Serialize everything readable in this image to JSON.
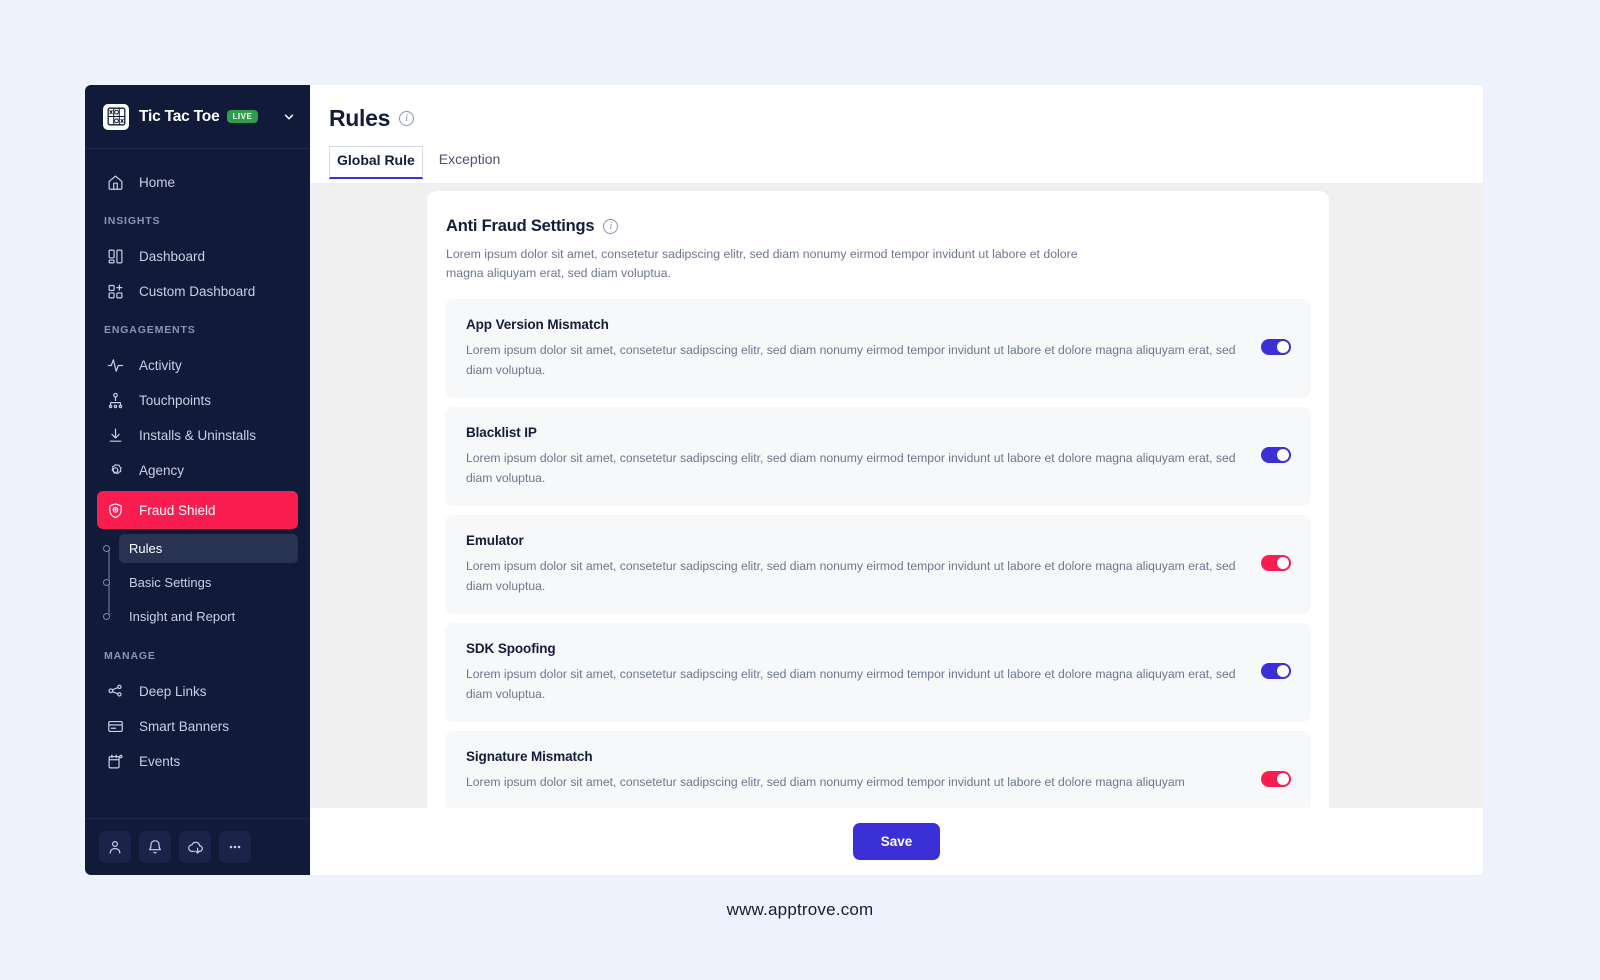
{
  "sidebar": {
    "brand": {
      "logo_icon": "tic-tac-toe-icon",
      "name": "Tic Tac Toe",
      "badge": "LIVE",
      "caret_icon": "chevron-down-icon"
    },
    "top_items": [
      {
        "label": "Home",
        "icon": "home-icon"
      }
    ],
    "sections": [
      {
        "label": "INSIGHTS",
        "items": [
          {
            "label": "Dashboard",
            "icon": "dashboard-icon"
          },
          {
            "label": "Custom Dashboard",
            "icon": "custom-dashboard-icon"
          }
        ]
      },
      {
        "label": "ENGAGEMENTS",
        "items": [
          {
            "label": "Activity",
            "icon": "activity-pulse-icon"
          },
          {
            "label": "Touchpoints",
            "icon": "touchpoints-icon"
          },
          {
            "label": "Installs & Uninstalls",
            "icon": "download-icon"
          },
          {
            "label": "Agency",
            "icon": "agency-target-icon"
          },
          {
            "label": "Fraud Shield",
            "icon": "shield-icon",
            "active": true
          }
        ],
        "subitems": [
          {
            "label": "Rules",
            "selected": true
          },
          {
            "label": "Basic Settings",
            "selected": false
          },
          {
            "label": "Insight and Report",
            "selected": false
          }
        ]
      },
      {
        "label": "MANAGE",
        "items": [
          {
            "label": "Deep Links",
            "icon": "deep-links-icon"
          },
          {
            "label": "Smart Banners",
            "icon": "smart-banners-icon"
          },
          {
            "label": "Events",
            "icon": "events-calendar-icon"
          }
        ]
      }
    ],
    "footer_buttons": [
      {
        "icon": "user-icon"
      },
      {
        "icon": "bell-icon"
      },
      {
        "icon": "cloud-download-icon"
      },
      {
        "icon": "more-ellipsis-icon"
      }
    ]
  },
  "header": {
    "title": "Rules",
    "info_icon": "info-icon",
    "tabs": [
      {
        "label": "Global Rule",
        "active": true
      },
      {
        "label": "Exception",
        "active": false
      }
    ]
  },
  "settings": {
    "title": "Anti Fraud Settings",
    "info_icon": "info-icon",
    "description": "Lorem ipsum dolor sit amet, consetetur sadipscing elitr, sed diam nonumy eirmod tempor invidunt ut labore et dolore magna aliquyam erat, sed diam voluptua.",
    "rules": [
      {
        "name": "App Version Mismatch",
        "description": "Lorem ipsum dolor sit amet, consetetur sadipscing elitr, sed diam nonumy eirmod tempor invidunt ut labore et dolore magna aliquyam erat, sed diam voluptua.",
        "enabled": true,
        "color": "#3b2fd6"
      },
      {
        "name": "Blacklist IP",
        "description": "Lorem ipsum dolor sit amet, consetetur sadipscing elitr, sed diam nonumy eirmod tempor invidunt ut labore et dolore magna aliquyam erat, sed diam voluptua.",
        "enabled": true,
        "color": "#3b2fd6"
      },
      {
        "name": "Emulator",
        "description": "Lorem ipsum dolor sit amet, consetetur sadipscing elitr, sed diam nonumy eirmod tempor invidunt ut labore et dolore magna aliquyam erat, sed diam voluptua.",
        "enabled": true,
        "color": "#fa1e50"
      },
      {
        "name": "SDK Spoofing",
        "description": "Lorem ipsum dolor sit amet, consetetur sadipscing elitr, sed diam nonumy eirmod tempor invidunt ut labore et dolore magna aliquyam erat, sed diam voluptua.",
        "enabled": true,
        "color": "#3b2fd6"
      },
      {
        "name": "Signature Mismatch",
        "description": "Lorem ipsum dolor sit amet, consetetur sadipscing elitr, sed diam nonumy eirmod tempor invidunt ut labore et dolore magna aliquyam",
        "enabled": true,
        "color": "#fa1e50"
      }
    ]
  },
  "save_bar": {
    "label": "Save"
  },
  "footer": {
    "url": "www.apptrove.com"
  },
  "colors": {
    "sidebar_bg": "#121a3a",
    "accent_pink": "#fa1e50",
    "accent_blue": "#3b2fd6",
    "page_bg": "#eef2fc",
    "live_green": "#2e9e4b"
  }
}
